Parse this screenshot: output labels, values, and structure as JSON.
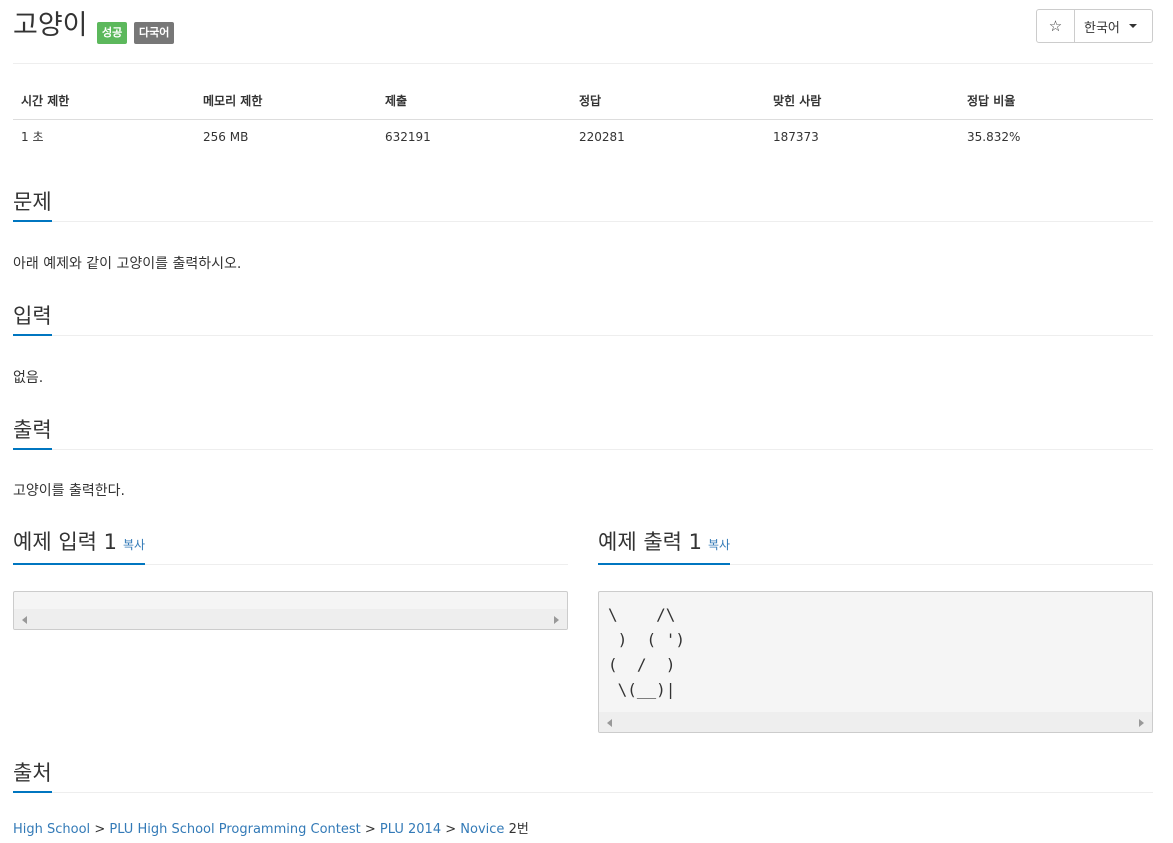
{
  "problem": {
    "title": "고양이",
    "badges": {
      "success": "성공",
      "multilang": "다국어"
    }
  },
  "toolbar": {
    "star_icon": "star-icon",
    "language_label": "한국어"
  },
  "info_table": {
    "headers": [
      "시간 제한",
      "메모리 제한",
      "제출",
      "정답",
      "맞힌 사람",
      "정답 비율"
    ],
    "values": [
      "1 초",
      "256 MB",
      "632191",
      "220281",
      "187373",
      "35.832%"
    ]
  },
  "sections": {
    "description": {
      "heading": "문제",
      "text": "아래 예제와 같이 고양이를 출력하시오."
    },
    "input": {
      "heading": "입력",
      "text": "없음."
    },
    "output": {
      "heading": "출력",
      "text": "고양이를 출력한다."
    }
  },
  "samples": {
    "input_heading": "예제 입력 1",
    "output_heading": "예제 출력 1",
    "copy_label": "복사",
    "input_text": "",
    "output_text": "\\    /\\\n )  ( ')\n(  /  )\n \\(__)|"
  },
  "source": {
    "heading": "출처",
    "crumbs": [
      "High School",
      "PLU High School Programming Contest",
      "PLU 2014",
      "Novice"
    ],
    "suffix": "2번"
  },
  "colors": {
    "accent": "#0076c0",
    "link": "#337ab7",
    "success": "#5cb85c",
    "badge_gray": "#777777"
  }
}
